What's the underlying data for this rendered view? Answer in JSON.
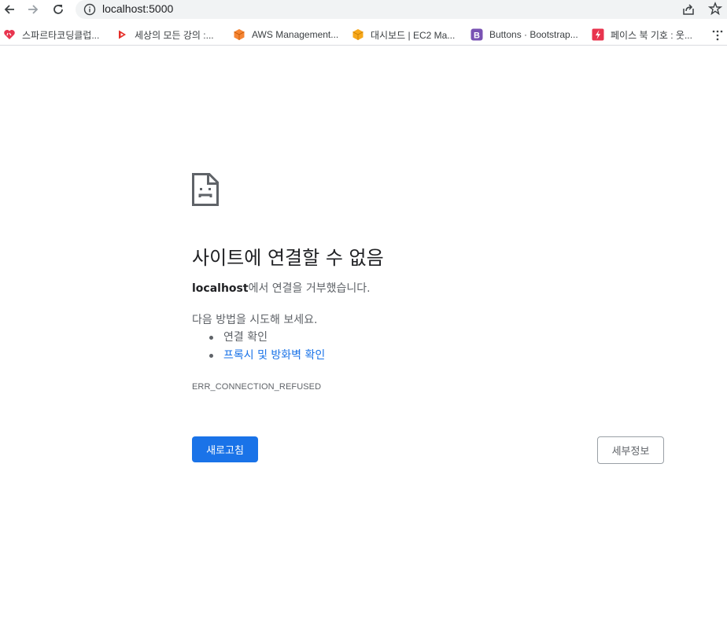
{
  "browser": {
    "url": "localhost:5000",
    "nav": {
      "back_icon": "back-arrow-icon",
      "forward_icon": "forward-arrow-icon",
      "reload_icon": "reload-icon"
    },
    "omnibox_icons": [
      "info-icon",
      "share-icon",
      "star-icon"
    ]
  },
  "bookmarks": [
    {
      "label": "스파르타코딩클럽...",
      "icon": "sparta-heart-icon",
      "color": "#e8344e"
    },
    {
      "label": "세상의 모든 강의 :...",
      "icon": "play-icon",
      "color": "#e52d27"
    },
    {
      "label": "AWS Management...",
      "icon": "aws-cube-icon",
      "color": "#f58534"
    },
    {
      "label": "대시보드 | EC2 Ma...",
      "icon": "aws-ec2-icon",
      "color": "#f7a81b"
    },
    {
      "label": "Buttons · Bootstrap...",
      "icon": "bootstrap-icon",
      "color": "#7952b3"
    },
    {
      "label": "페이스 북 기호 : 웃...",
      "icon": "lightning-icon",
      "color": "#e8344e"
    }
  ],
  "error": {
    "title": "사이트에 연결할 수 없음",
    "host": "localhost",
    "desc_suffix": "에서 연결을 거부했습니다.",
    "suggest_heading": "다음 방법을 시도해 보세요.",
    "suggestions": [
      "연결 확인",
      "프록시 및 방화벽 확인"
    ],
    "code": "ERR_CONNECTION_REFUSED",
    "reload_label": "새로고침",
    "details_label": "세부정보"
  },
  "colors": {
    "primary_button": "#1a73e8",
    "link": "#1a73e8",
    "text_secondary": "#5f6368"
  }
}
